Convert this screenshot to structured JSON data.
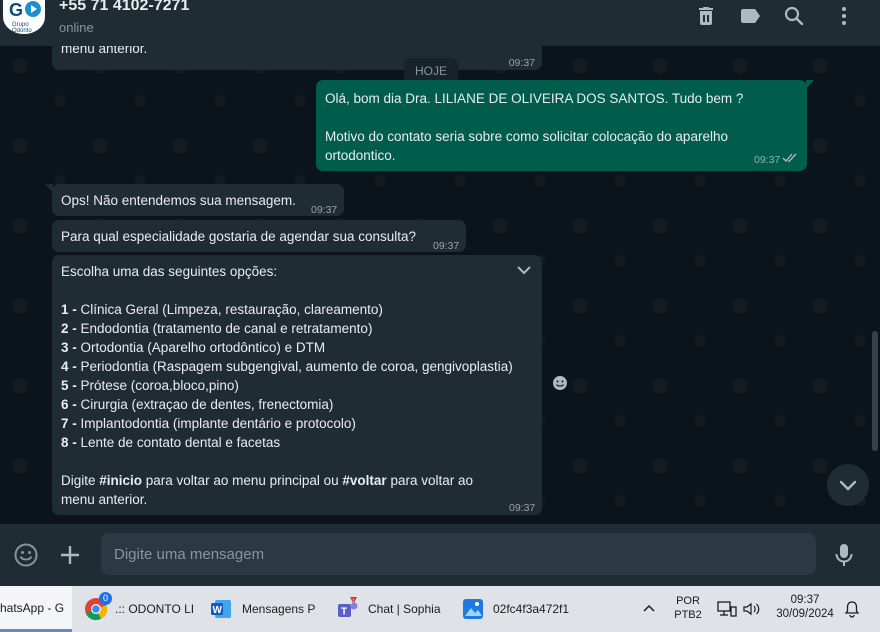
{
  "header": {
    "contact_name": "+55 71 4102-7271",
    "status": "online",
    "avatar_text": "G",
    "avatar_sub": "Grupo Odonto"
  },
  "chat": {
    "date_chip": "HOJE",
    "top_partial": {
      "text": "menu anterior.",
      "time": "09:37"
    },
    "outgoing": {
      "line1": "Olá, bom dia Dra. LILIANE DE OLIVEIRA DOS SANTOS. Tudo bem ?",
      "line2": "Motivo do contato seria sobre como solicitar colocação do aparelho",
      "line3": "ortodontico.",
      "time": "09:37"
    },
    "msg_ops": {
      "text": "Ops! Não entendemos sua mensagem.",
      "time": "09:37"
    },
    "msg_question": {
      "text": "Para qual especialidade gostaria de agendar sua consulta?",
      "time": "09:37"
    },
    "menu": {
      "intro": "Escolha uma das seguintes opções:",
      "options": [
        {
          "num": "1 -",
          "text": " Clínica Geral (Limpeza, restauração, clareamento)"
        },
        {
          "num": "2 -",
          "text": " Endodontia (tratamento de canal e retratamento)"
        },
        {
          "num": "3 -",
          "text": " Ortodontia (Aparelho ortodôntico) e DTM"
        },
        {
          "num": "4 -",
          "text": " Periodontia (Raspagem subgengival, aumento de coroa, gengivoplastia)"
        },
        {
          "num": "5 -",
          "text": " Prótese (coroa,bloco,pino)"
        },
        {
          "num": "6 -",
          "text": " Cirurgia (extraçao de dentes, frenectomia)"
        },
        {
          "num": "7 -",
          "text": " Implantodontia (implante dentário e protocolo)"
        },
        {
          "num": "8 -",
          "text": " Lente de contato dental e facetas"
        }
      ],
      "footer_a": "Digite ",
      "footer_b": "#inicio",
      "footer_c": " para voltar ao menu principal ou ",
      "footer_d": "#voltar",
      "footer_e": " para voltar ao",
      "footer_line2": "menu anterior.",
      "time": "09:37"
    }
  },
  "input": {
    "placeholder": "Digite uma mensagem"
  },
  "taskbar": {
    "apps": [
      {
        "label": "hatsApp - G"
      },
      {
        "label": ".:: ODONTO LI",
        "badge": "0"
      },
      {
        "label": "Mensagens P"
      },
      {
        "label": "Chat | Sophia"
      },
      {
        "label": "02fc4f3a472f1"
      }
    ],
    "lang1": "POR",
    "lang2": "PTB2",
    "clock_time": "09:37",
    "clock_date": "30/09/2024"
  },
  "colors": {
    "header_bg": "#202c33",
    "chat_bg": "#0b141a",
    "incoming_bubble": "#202c33",
    "outgoing_bubble": "#005c4b",
    "accent": "#00a884",
    "taskbar_bg": "#dfe3e8"
  }
}
